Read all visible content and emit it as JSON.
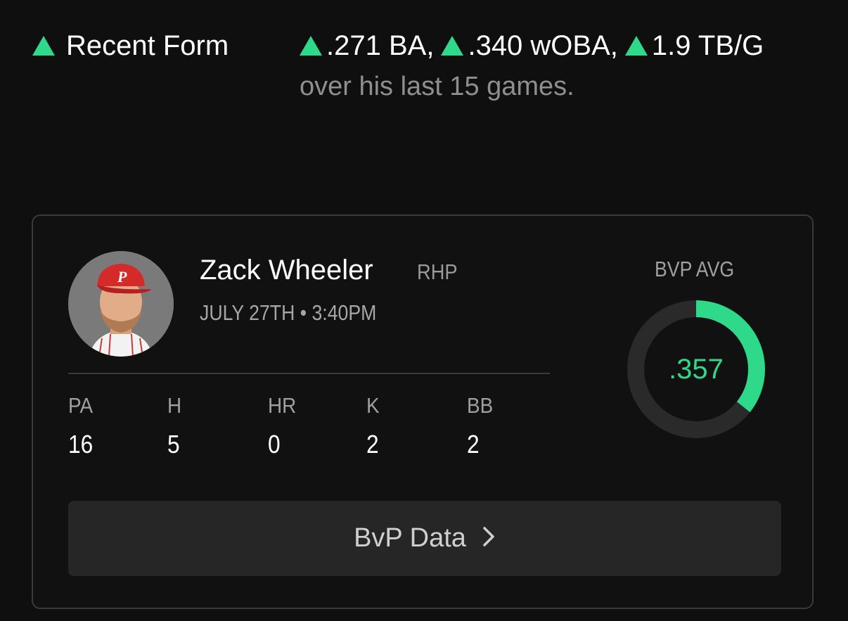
{
  "recent_form": {
    "label": "Recent Form",
    "stats": [
      ".271 BA",
      ".340 wOBA",
      "1.9 TB/G"
    ],
    "trend": "up",
    "subtext": "over his last 15 games."
  },
  "matchup": {
    "pitcher_name": "Zack Wheeler",
    "pitcher_hand": "RHP",
    "game_time": "JULY 27TH • 3:40PM",
    "stats": [
      {
        "label": "PA",
        "value": "16"
      },
      {
        "label": "H",
        "value": "5"
      },
      {
        "label": "HR",
        "value": "0"
      },
      {
        "label": "K",
        "value": "2"
      },
      {
        "label": "BB",
        "value": "2"
      }
    ],
    "bvp_avg_label": "BVP AVG",
    "bvp_avg_value": ".357",
    "bvp_avg_fraction": 0.357,
    "button_label": "BvP Data"
  },
  "colors": {
    "accent_green": "#2fd98a",
    "background": "#0f0f0f",
    "card_border": "#3a3a3a",
    "button_bg": "#262626",
    "ring_track": "#2a2a2a"
  },
  "icons": {
    "trend": "triangle-up-icon",
    "button": "chevron-right-icon",
    "team_logo": "phillies-logo"
  }
}
